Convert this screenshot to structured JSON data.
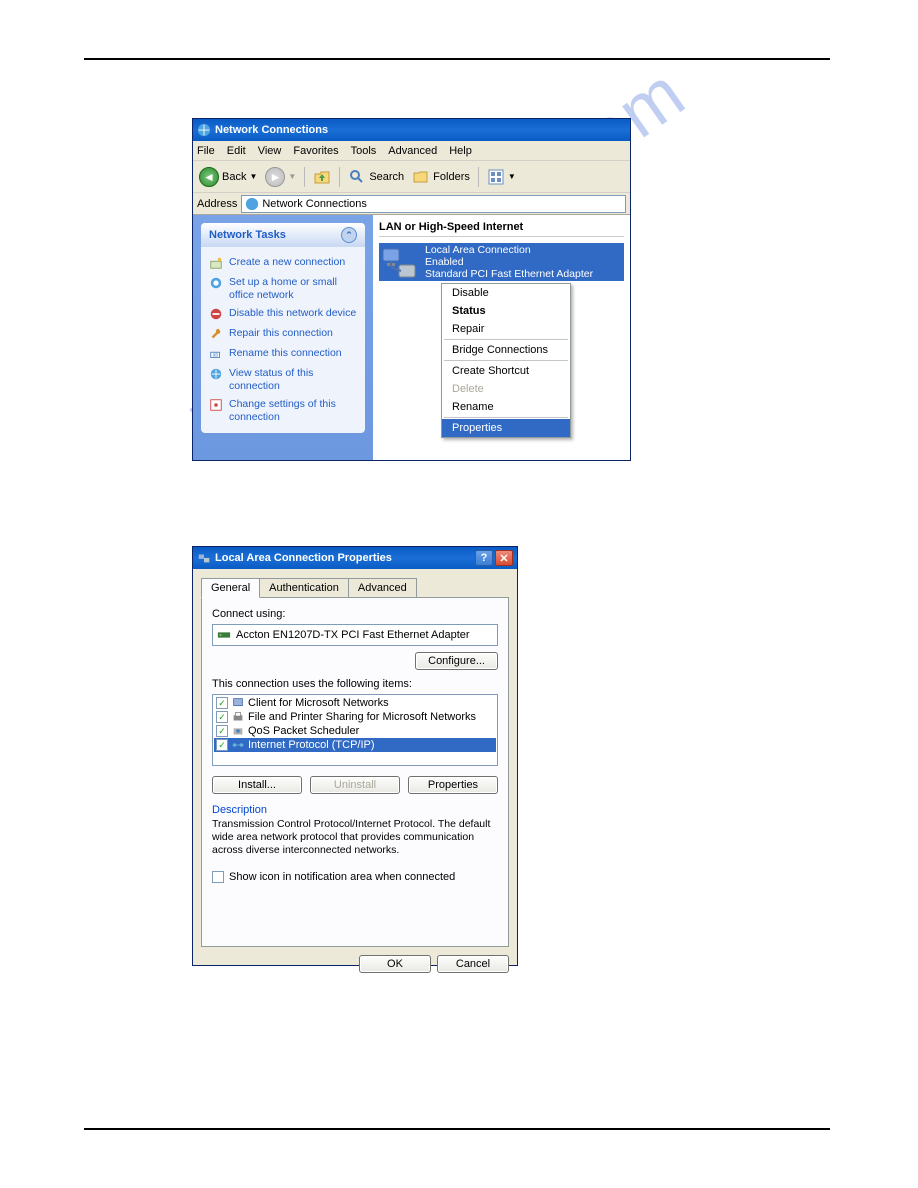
{
  "watermark": "manualshive.com",
  "win1": {
    "title": "Network Connections",
    "menus": [
      "File",
      "Edit",
      "View",
      "Favorites",
      "Tools",
      "Advanced",
      "Help"
    ],
    "toolbar": {
      "back": "Back",
      "search": "Search",
      "folders": "Folders"
    },
    "address_label": "Address",
    "address_value": "Network Connections",
    "tasks_header": "Network Tasks",
    "tasks": [
      "Create a new connection",
      "Set up a home or small office network",
      "Disable this network device",
      "Repair this connection",
      "Rename this connection",
      "View status of this connection",
      "Change settings of this connection"
    ],
    "section": "LAN or High-Speed Internet",
    "conn": {
      "name": "Local Area Connection",
      "status": "Enabled",
      "adapter": "Standard PCI Fast Ethernet Adapter"
    },
    "menu": {
      "disable": "Disable",
      "status": "Status",
      "repair": "Repair",
      "bridge": "Bridge Connections",
      "shortcut": "Create Shortcut",
      "delete": "Delete",
      "rename": "Rename",
      "properties": "Properties"
    }
  },
  "win2": {
    "title": "Local Area Connection Properties",
    "tabs": [
      "General",
      "Authentication",
      "Advanced"
    ],
    "connect_using_label": "Connect using:",
    "adapter": "Accton EN1207D-TX PCI Fast Ethernet Adapter",
    "configure": "Configure...",
    "items_label": "This connection uses the following items:",
    "items": [
      "Client for Microsoft Networks",
      "File and Printer Sharing for Microsoft Networks",
      "QoS Packet Scheduler",
      "Internet Protocol (TCP/IP)"
    ],
    "install": "Install...",
    "uninstall": "Uninstall",
    "properties": "Properties",
    "desc_title": "Description",
    "desc": "Transmission Control Protocol/Internet Protocol. The default wide area network protocol that provides communication across diverse interconnected networks.",
    "show_icon": "Show icon in notification area when connected",
    "ok": "OK",
    "cancel": "Cancel"
  }
}
